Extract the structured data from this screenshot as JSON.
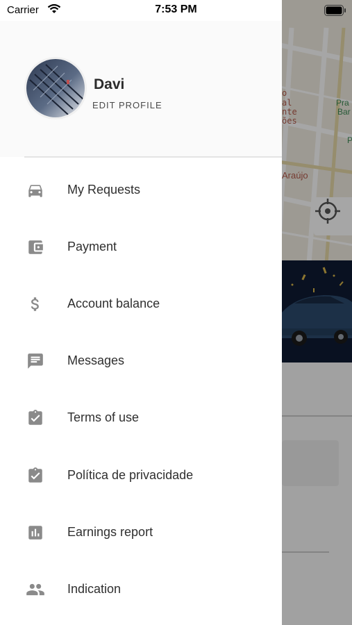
{
  "status_bar": {
    "carrier": "Carrier",
    "time": "7:53 PM"
  },
  "profile": {
    "name": "Davi",
    "edit_label": "EDIT PROFILE"
  },
  "menu": [
    {
      "label": "My Requests",
      "icon": "car-icon"
    },
    {
      "label": "Payment",
      "icon": "wallet-icon"
    },
    {
      "label": "Account balance",
      "icon": "dollar-icon"
    },
    {
      "label": "Messages",
      "icon": "message-icon"
    },
    {
      "label": "Terms of use",
      "icon": "clipboard-check-icon"
    },
    {
      "label": "Política de privacidade",
      "icon": "clipboard-check-icon"
    },
    {
      "label": "Earnings report",
      "icon": "bar-chart-icon"
    },
    {
      "label": "Indication",
      "icon": "people-icon"
    }
  ],
  "map": {
    "labels": [
      "o",
      "al",
      "nte",
      "ões",
      "Araújo",
      "Pra",
      "Bar",
      "P"
    ]
  },
  "colors": {
    "icon": "#8a8a8a",
    "text": "#2f2f2f",
    "drawer_bg": "#ffffff",
    "header_bg": "#fafafa"
  }
}
